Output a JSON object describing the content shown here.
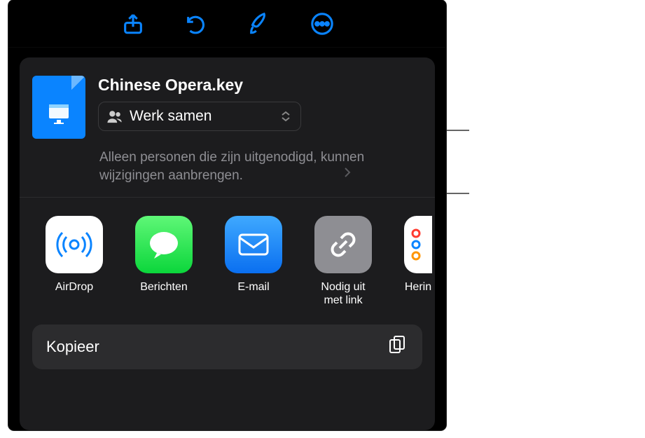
{
  "toolbar": {
    "share_name": "share-button",
    "undo_name": "undo-button",
    "format_name": "format-button",
    "more_name": "more-button"
  },
  "doc": {
    "title": "Chinese Opera.key"
  },
  "collab": {
    "label": "Werk samen"
  },
  "permissions": {
    "text": "Alleen personen die zijn uitgenodigd, kunnen wijzigingen aanbrengen."
  },
  "apps": {
    "airdrop": "AirDrop",
    "messages": "Berichten",
    "mail": "E-mail",
    "invite_link": "Nodig uit met link",
    "reminders": "Herin"
  },
  "actions": {
    "copy": "Kopieer"
  }
}
